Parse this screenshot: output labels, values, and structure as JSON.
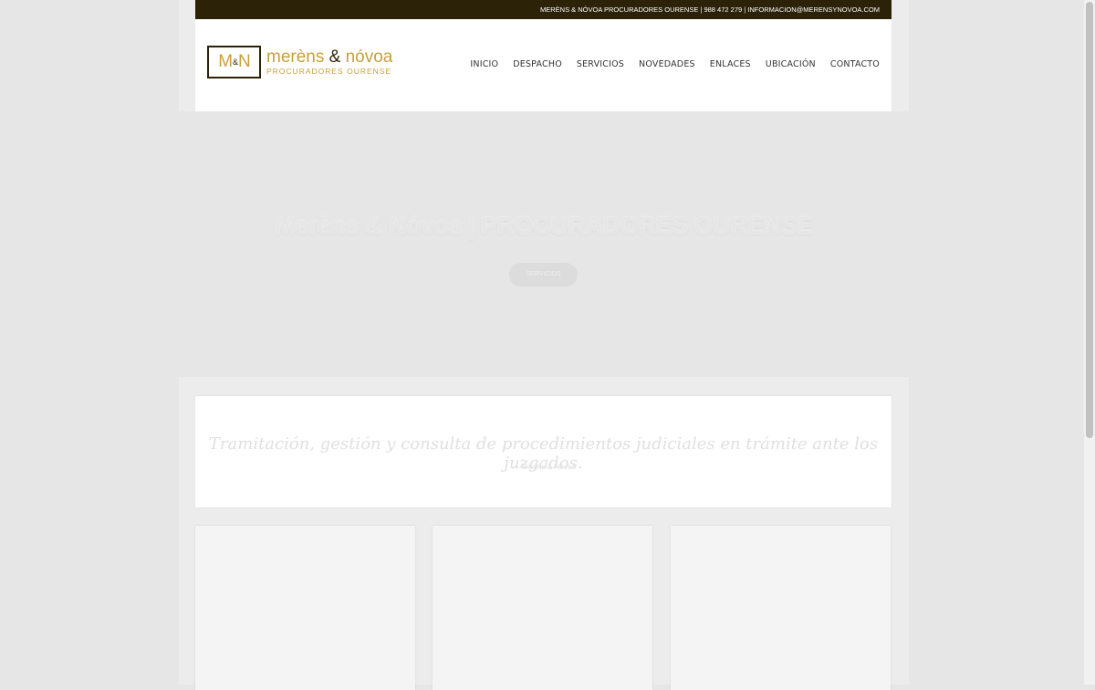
{
  "topbar": {
    "text": "MERÈNS & NÓVOA PROCURADORES OURENSE | 988 472 279 | INFORMACION@MERENSYNOVOA.COM"
  },
  "logo": {
    "monogram_m": "M",
    "monogram_amp": "&",
    "monogram_n": "N",
    "name_part1": "merèns ",
    "name_amp": "&",
    "name_part2": " nóvoa",
    "subtitle": "PROCURADORES OURENSE"
  },
  "nav": {
    "items": [
      {
        "label": "INICIO"
      },
      {
        "label": "DESPACHO"
      },
      {
        "label": "SERVICIOS"
      },
      {
        "label": "NOVEDADES"
      },
      {
        "label": "ENLACES"
      },
      {
        "label": "UBICACIÓN"
      },
      {
        "label": "CONTACTO"
      }
    ]
  },
  "hero": {
    "title": "Merèns & Nóvoa | PROCURADORES OURENSE",
    "button_label": "SERVICIOS"
  },
  "quote": {
    "text": "Tramitación, gestión y consulta de procedimientos judiciales en trámite ante los juzgados.",
    "author": "— Merèns & Nóvoa"
  },
  "colors": {
    "brand_dark": "#2b2208",
    "brand_gold": "#c8a03a",
    "page_bg": "#e6e6e6"
  }
}
